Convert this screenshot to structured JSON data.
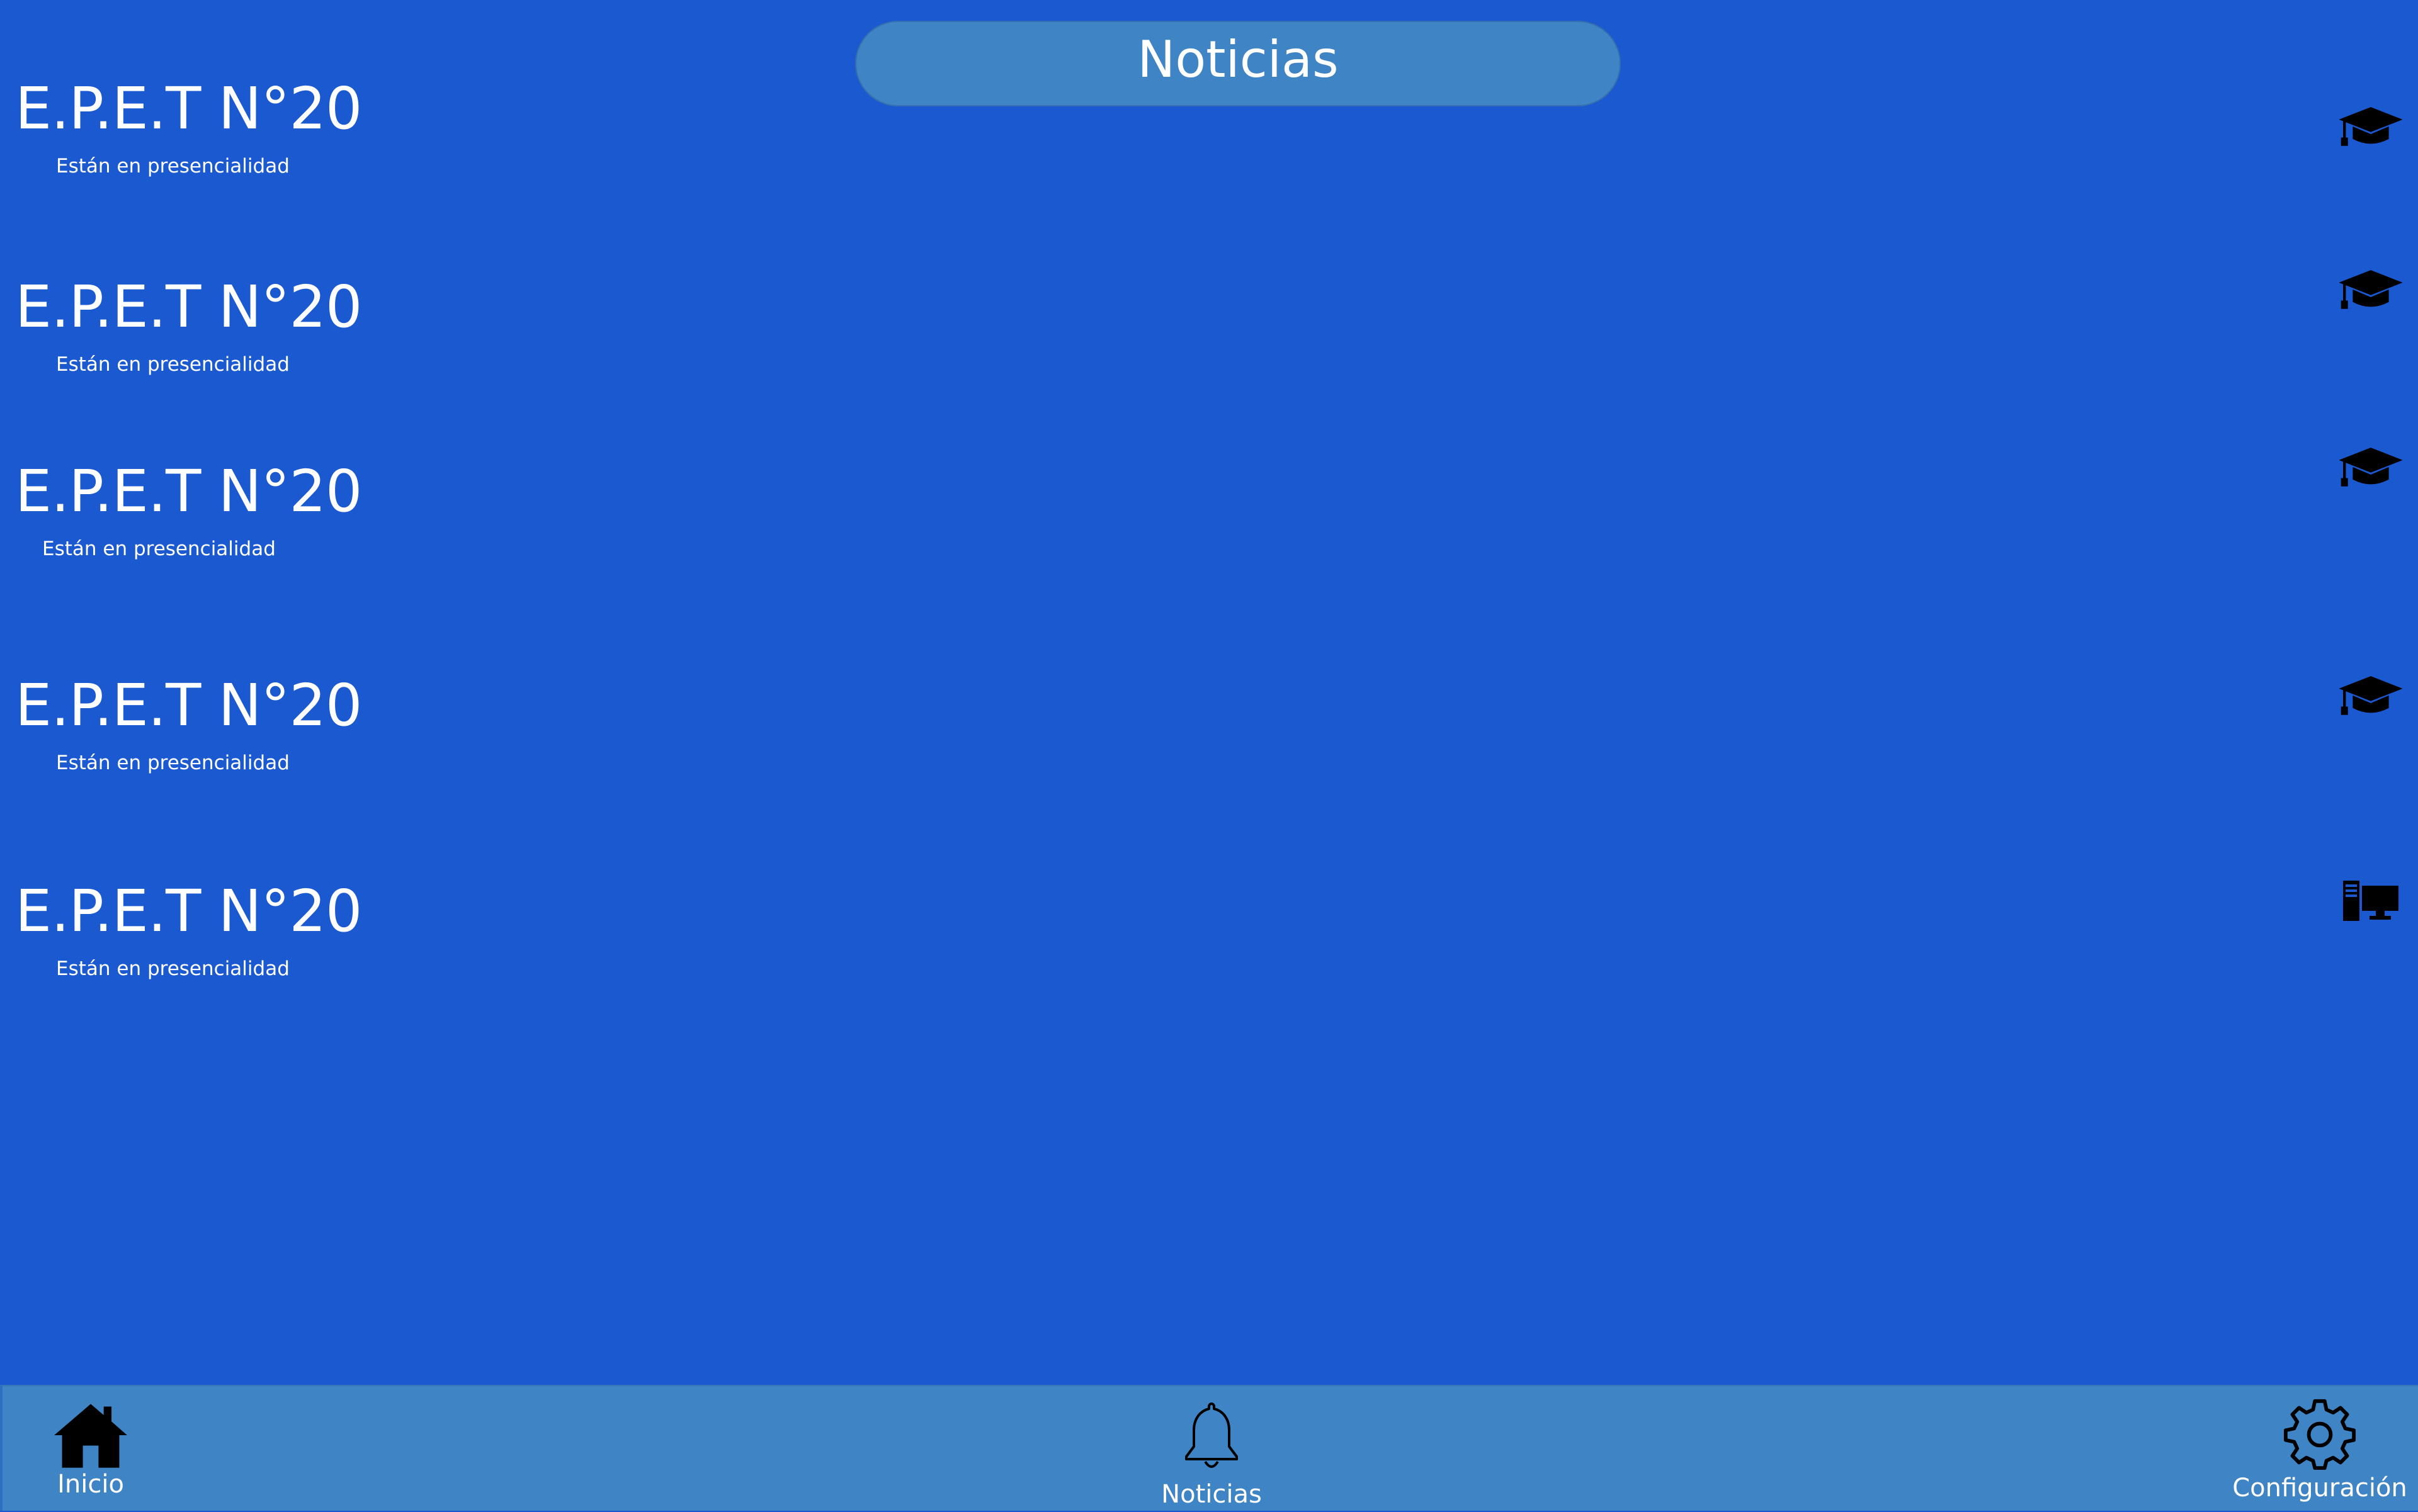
{
  "header": {
    "title": "Noticias"
  },
  "news": [
    {
      "title": "E.P.E.T N°20",
      "subtitle": "Están en presencialidad",
      "icon": "graduation-cap-icon"
    },
    {
      "title": "E.P.E.T N°20",
      "subtitle": "Están en presencialidad",
      "icon": "graduation-cap-icon"
    },
    {
      "title": "E.P.E.T N°20",
      "subtitle": "Están en presencialidad",
      "icon": "graduation-cap-icon"
    },
    {
      "title": "E.P.E.T N°20",
      "subtitle": "Están en presencialidad",
      "icon": "graduation-cap-icon"
    },
    {
      "title": "E.P.E.T N°20",
      "subtitle": "Están en presencialidad",
      "icon": "desktop-computer-icon"
    }
  ],
  "nav": {
    "home_label": "Inicio",
    "news_label": "Noticias",
    "config_label": "Configuración"
  },
  "colors": {
    "background": "#1a59d0",
    "header_pill": "#3f84c4",
    "bottom_bar": "#3f84c4",
    "text": "#ffffff",
    "icon": "#000000"
  }
}
